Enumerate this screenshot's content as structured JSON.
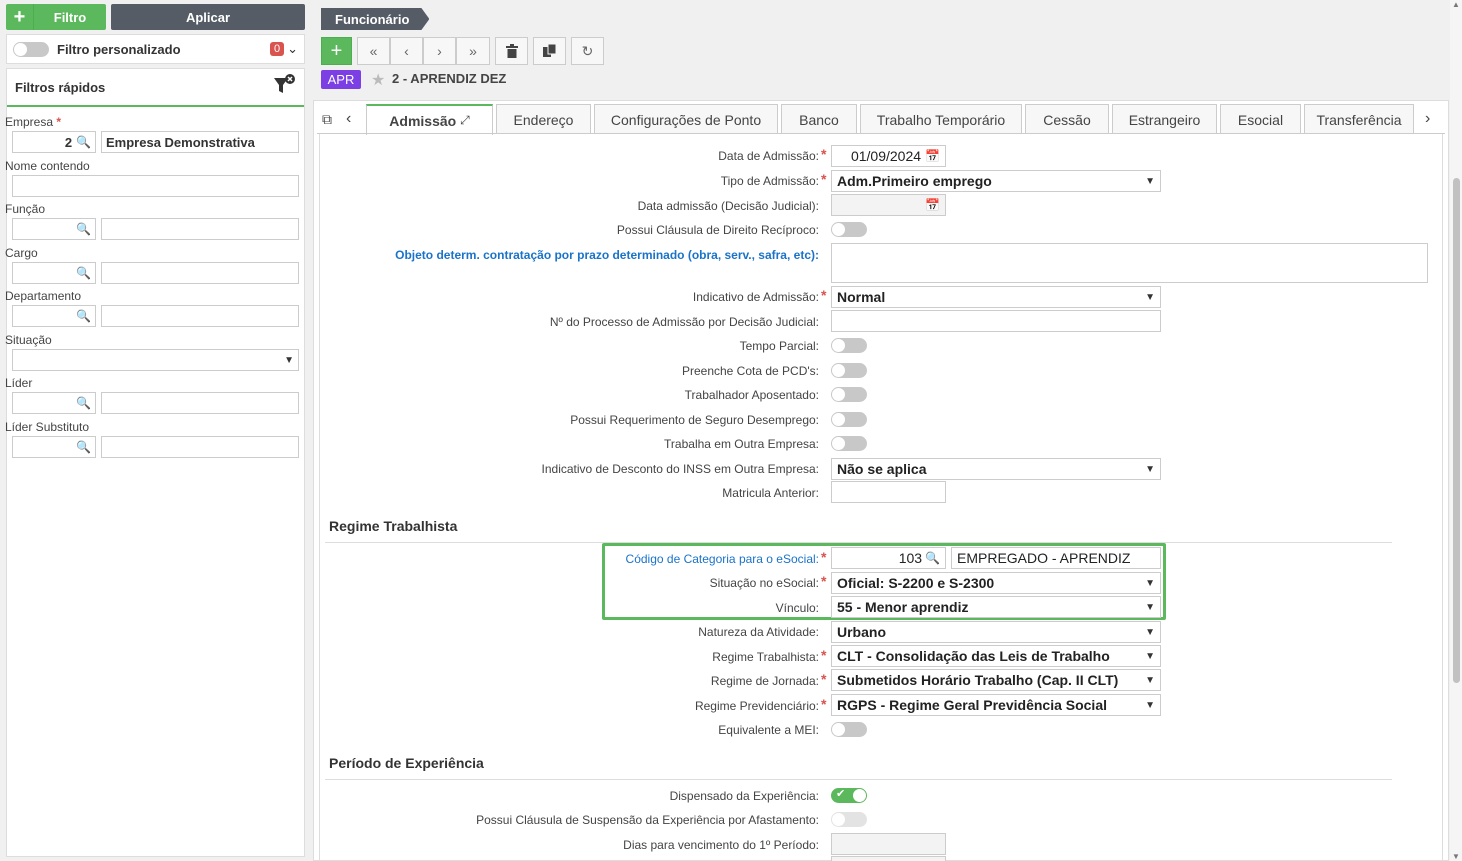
{
  "sidebar": {
    "filtro_label": "Filtro",
    "aplicar_label": "Aplicar",
    "filtro_personalizado": "Filtro personalizado",
    "filtro_count": "0",
    "quick_title": "Filtros rápidos",
    "empresa_label": "Empresa",
    "empresa_code": "2",
    "empresa_name": "Empresa Demonstrativa",
    "nome_label": "Nome contendo",
    "funcao_label": "Função",
    "cargo_label": "Cargo",
    "departamento_label": "Departamento",
    "situacao_label": "Situação",
    "lider_label": "Líder",
    "lider_sub_label": "Líder Substituto"
  },
  "header": {
    "breadcrumb": "Funcionário",
    "badge": "APR",
    "employee": "2 - APRENDIZ DEZ"
  },
  "tabs": [
    "Admissão",
    "Endereço",
    "Configurações de Ponto",
    "Banco",
    "Trabalho Temporário",
    "Cessão",
    "Estrangeiro",
    "Esocial",
    "Transferência"
  ],
  "form": {
    "data_admissao_label": "Data de Admissão:",
    "data_admissao": "01/09/2024",
    "tipo_admissao_label": "Tipo de Admissão:",
    "tipo_admissao": "Adm.Primeiro emprego",
    "data_judicial_label": "Data admissão (Decisão Judicial):",
    "clausula_label": "Possui Cláusula de Direito Recíproco:",
    "objeto_label": "Objeto determ. contratação por prazo determinado (obra, serv., safra, etc):",
    "indicativo_label": "Indicativo de Admissão:",
    "indicativo": "Normal",
    "processo_label": "Nº do Processo de Admissão por Decisão Judicial:",
    "tempo_parcial_label": "Tempo Parcial:",
    "pcd_label": "Preenche Cota de PCD's:",
    "aposentado_label": "Trabalhador Aposentado:",
    "seguro_label": "Possui Requerimento de Seguro Desemprego:",
    "outra_empresa_label": "Trabalha em Outra Empresa:",
    "inss_label": "Indicativo de Desconto do INSS em Outra Empresa:",
    "inss": "Não se aplica",
    "matricula_label": "Matricula Anterior:",
    "regime_section": "Regime Trabalhista",
    "categoria_label": "Código de Categoria para o eSocial:",
    "categoria_code": "103",
    "categoria_desc": "EMPREGADO - APRENDIZ",
    "situacao_esocial_label": "Situação no eSocial:",
    "situacao_esocial": "Oficial: S-2200 e S-2300",
    "vinculo_label": "Vínculo:",
    "vinculo": "55 - Menor aprendiz",
    "natureza_label": "Natureza da Atividade:",
    "natureza": "Urbano",
    "regime_trab_label": "Regime Trabalhista:",
    "regime_trab": "CLT - Consolidação das Leis de Trabalho",
    "jornada_label": "Regime de Jornada:",
    "jornada": "Submetidos Horário Trabalho (Cap. II CLT)",
    "previd_label": "Regime Previdenciário:",
    "previd": "RGPS - Regime Geral Previdência Social",
    "mei_label": "Equivalente a MEI:",
    "experiencia_section": "Período de Experiência",
    "dispensado_label": "Dispensado da Experiência:",
    "suspensao_label": "Possui Cláusula de Suspensão da Experiência por Afastamento:",
    "dias_label": "Dias para vencimento do 1º Período:"
  }
}
